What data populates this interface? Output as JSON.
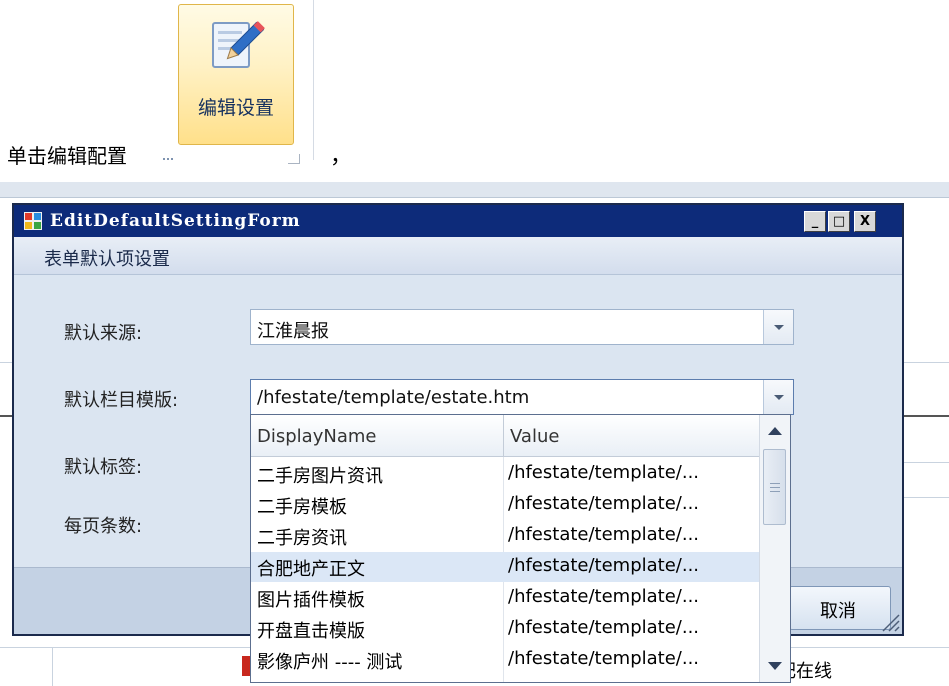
{
  "ribbon": {
    "edit_settings_label": "编辑设置"
  },
  "instruction": {
    "text": "单击编辑配置",
    "comma": "，"
  },
  "background": {
    "right_text": "合肥在线"
  },
  "dialog": {
    "title": "EditDefaultSettingForm",
    "minimize": "_",
    "maximize": "□",
    "close": "X",
    "group_title": "表单默认项设置",
    "fields": {
      "default_source_label": "默认来源:",
      "default_source_value": "江淮晨报",
      "default_template_label": "默认栏目模版:",
      "default_template_value": "/hfestate/template/estate.htm",
      "default_tag_label": "默认标签:",
      "page_size_label": "每页条数:"
    },
    "cancel_button": "取消"
  },
  "dropdown": {
    "columns": [
      "DisplayName",
      "Value"
    ],
    "selected_index": 3,
    "rows": [
      {
        "name": "二手房图片资讯",
        "value": "/hfestate/template/..."
      },
      {
        "name": "二手房模板",
        "value": "/hfestate/template/..."
      },
      {
        "name": "二手房资讯",
        "value": "/hfestate/template/..."
      },
      {
        "name": "合肥地产正文",
        "value": "/hfestate/template/..."
      },
      {
        "name": "图片插件模板",
        "value": "/hfestate/template/..."
      },
      {
        "name": "开盘直击模版",
        "value": "/hfestate/template/..."
      },
      {
        "name": "影像庐州 ---- 测试",
        "value": "/hfestate/template/..."
      }
    ]
  },
  "colors": {
    "titlebar": "#0d2b7a",
    "dialog_bg": "#dbe5f1",
    "selected_row": "#dbe7f6",
    "ribbon_highlight": "#ffe08a"
  }
}
